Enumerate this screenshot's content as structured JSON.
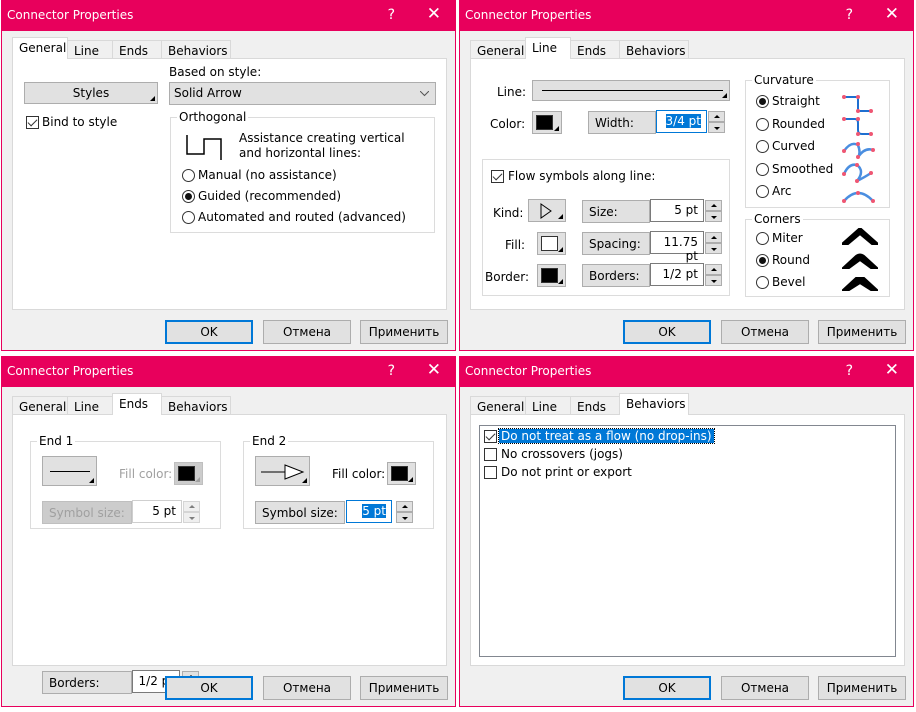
{
  "dialog_title": "Connector Properties",
  "help_label": "?",
  "close_label": "✕",
  "tabs": [
    "General",
    "Line",
    "Ends",
    "Behaviors"
  ],
  "buttons": {
    "ok": "OK",
    "cancel": "Отмена",
    "apply": "Применить"
  },
  "general": {
    "styles_button": "Styles",
    "based_on_label": "Based on style:",
    "based_on_value": "Solid Arrow",
    "bind_to_style": {
      "label": "Bind to style",
      "checked": true
    },
    "orthogonal": {
      "title": "Orthogonal",
      "description": "Assistance creating vertical and horizontal lines:",
      "options": [
        {
          "label": "Manual (no assistance)",
          "selected": false
        },
        {
          "label": "Guided (recommended)",
          "selected": true
        },
        {
          "label": "Automated and routed (advanced)",
          "selected": false
        }
      ]
    }
  },
  "line": {
    "line_label": "Line:",
    "color_label": "Color:",
    "color_value": "#000000",
    "width_label": "Width:",
    "width_value": "3/4 pt",
    "flow": {
      "label": "Flow symbols along line:",
      "checked": true,
      "kind_label": "Kind:",
      "fill_label": "Fill:",
      "fill_value": "#ffffff",
      "border_label": "Border:",
      "border_value": "#000000",
      "size_label": "Size:",
      "size_value": "5 pt",
      "spacing_label": "Spacing:",
      "spacing_value": "11.75 pt",
      "borders_label": "Borders:",
      "borders_value": "1/2 pt"
    },
    "curvature": {
      "title": "Curvature",
      "options": [
        {
          "label": "Straight",
          "selected": true
        },
        {
          "label": "Rounded",
          "selected": false
        },
        {
          "label": "Curved",
          "selected": false
        },
        {
          "label": "Smoothed",
          "selected": false
        },
        {
          "label": "Arc",
          "selected": false
        }
      ]
    },
    "corners": {
      "title": "Corners",
      "options": [
        {
          "label": "Miter",
          "selected": false
        },
        {
          "label": "Round",
          "selected": true
        },
        {
          "label": "Bevel",
          "selected": false
        }
      ]
    }
  },
  "ends": {
    "end1": {
      "title": "End 1",
      "fill_color_label": "Fill color:",
      "symbol_size_label": "Symbol size:",
      "symbol_size_value": "5 pt",
      "enabled": false
    },
    "end2": {
      "title": "End 2",
      "fill_color_label": "Fill color:",
      "symbol_size_label": "Symbol size:",
      "symbol_size_value": "5 pt",
      "enabled": true
    },
    "borders_label": "Borders:",
    "borders_value": "1/2 pt"
  },
  "behaviors": {
    "items": [
      {
        "label": "Do not treat as a flow (no drop-ins)",
        "checked": true,
        "highlighted": true
      },
      {
        "label": "No crossovers (jogs)",
        "checked": false,
        "highlighted": false
      },
      {
        "label": "Do not print or export",
        "checked": false,
        "highlighted": false
      }
    ]
  },
  "colors": {
    "accent": "#e8005c",
    "focus": "#0078d7"
  }
}
